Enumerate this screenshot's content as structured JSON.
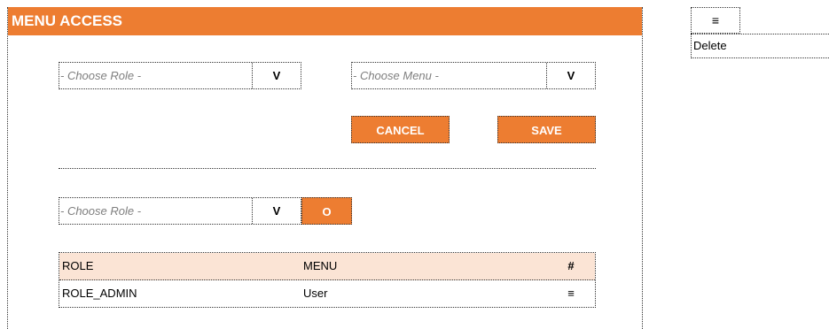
{
  "panel": {
    "title": "MENU ACCESS"
  },
  "form": {
    "role_select": {
      "placeholder": "- Choose Role -",
      "caret": "V"
    },
    "menu_select": {
      "placeholder": "- Choose Menu -",
      "caret": "V"
    },
    "cancel_label": "CANCEL",
    "save_label": "SAVE"
  },
  "filter": {
    "role_select": {
      "placeholder": "- Choose Role -",
      "caret": "V"
    },
    "go_label": "O"
  },
  "table": {
    "headers": {
      "role": "ROLE",
      "menu": "MENU",
      "action": "#"
    },
    "rows": [
      {
        "role": "ROLE_ADMIN",
        "menu": "User",
        "action_icon": "hamburger-icon",
        "action_glyph": "≡"
      }
    ]
  },
  "context_menu": {
    "trigger_glyph": "≡",
    "trigger_icon": "hamburger-icon",
    "items": [
      {
        "label": "Delete"
      }
    ]
  },
  "colors": {
    "accent": "#ed7d31",
    "header_row": "#fbe4d5"
  }
}
